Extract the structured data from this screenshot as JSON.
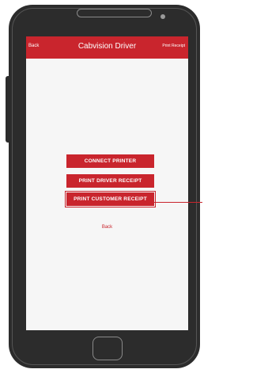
{
  "header": {
    "back_label": "Back",
    "title": "Cabvision Driver",
    "print_label": "Print Receipt"
  },
  "actions": {
    "connect_printer": "CONNECT PRINTER",
    "print_driver_receipt": "PRINT DRIVER RECEIPT",
    "print_customer_receipt": "PRINT CUSTOMER RECEIPT"
  },
  "footer": {
    "back_link": "Back"
  },
  "colors": {
    "accent": "#c9252d",
    "phone_body": "#2c2c2c",
    "screen_bg": "#f6f6f6"
  }
}
